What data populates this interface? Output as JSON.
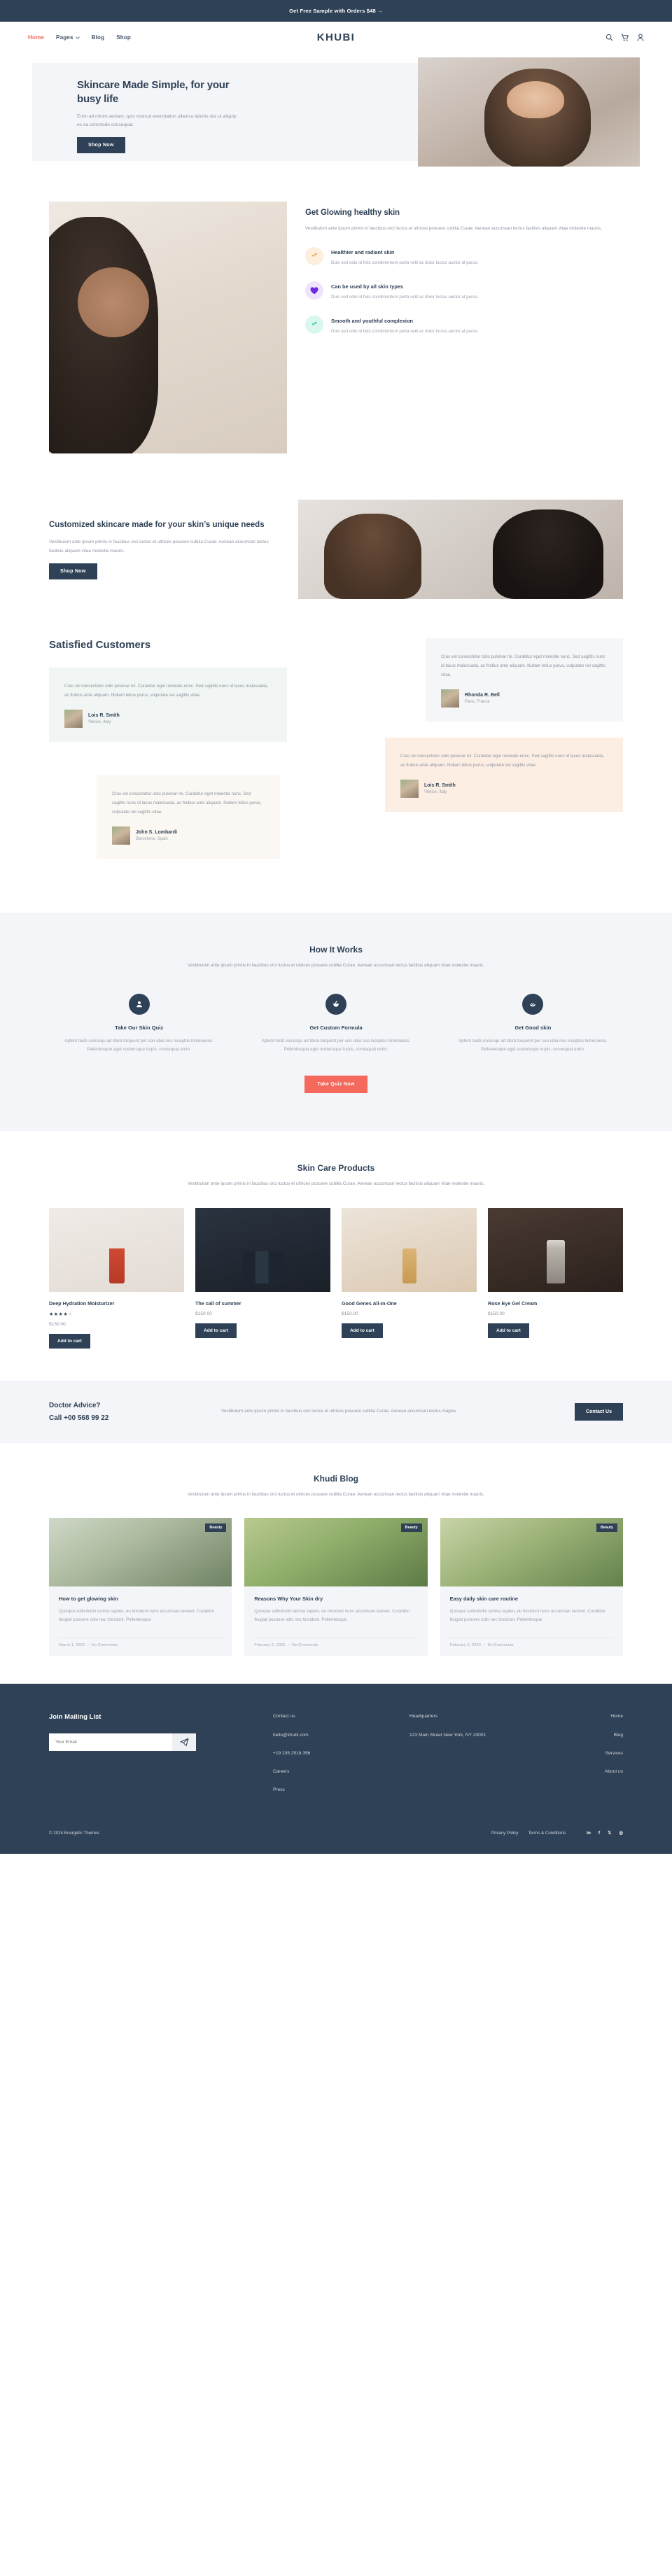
{
  "topbar": {
    "text": "Get Free Sample with Orders $48 →"
  },
  "header": {
    "brand": "KHUBI",
    "nav": [
      {
        "label": "Home",
        "active": true
      },
      {
        "label": "Pages",
        "active": false,
        "has_caret": true
      },
      {
        "label": "Blog",
        "active": false
      },
      {
        "label": "Shop",
        "active": false
      }
    ],
    "icons": [
      "search-icon",
      "cart-icon",
      "account-icon"
    ]
  },
  "hero": {
    "title": "Skincare Made Simple, for your busy life",
    "body": "Enim ad minim veniam, quis nostrud exercitation ullamco laboris nisi ut aliquip ex ea commodo consequat.",
    "cta": "Shop Now"
  },
  "glow": {
    "title": "Get Glowing healthy skin",
    "lead": "Vestibulum ante ipsum primis in faucibus orci luctus et ultrices posuere cubilia Curae. Aenean accumsan lectus facilisis aliquam vitae molestie mauris.",
    "features": [
      {
        "title": "Healthier and radiant skin",
        "body": "Duis sed odio id felis condimentum porta velit ac dolor luctus auctor at purus.",
        "icon": "sprout-icon",
        "icon_color": "#f0962e",
        "bg": "#fdeedd"
      },
      {
        "title": "Can be used by all skin types",
        "body": "Duis sed odio id felis condimentum porta velit ac dolor luctus auctor at purus.",
        "icon": "heart-icon",
        "icon_color": "#6d2ae2",
        "bg": "#eee4fd"
      },
      {
        "title": "Smooth and youthful complexion",
        "body": "Duis sed odio id felis condimentum porta velit ac dolor luctus auctor at purus.",
        "icon": "sprout-icon",
        "icon_color": "#12c79a",
        "bg": "#d9f7ee"
      }
    ]
  },
  "custom": {
    "title": "Customized skincare made for your skin’s unique needs",
    "body": "Vestibulum ante ipsum primis in faucibus orci luctus et ultrices posuere cubilia Curae. Aenean accumsan lectus facilisis aliquam vitae molestie mauris.",
    "cta": "Shop Now"
  },
  "testimonials": {
    "title": "Satisfied Customers",
    "items": [
      {
        "quote": "Cras vel consectetur odio pulvinar mi. Curabitur eget molestie nunc. Sed sagittis nunc id lacus malesuada, ac finibus ante aliquam. Nullam tellus purus, vulputate vel sagittis vitae.",
        "name": "Lois R. Smith",
        "location": "Venice, Italy"
      },
      {
        "quote": "Cras vel consectetur odio pulvinar mi. Curabitur eget molestie nunc. Sed sagittis nunc id lacus malesuada, ac finibus ante aliquam. Nullam tellus purus, vulputate vel sagittis vitae.",
        "name": "Rhonda R. Bell",
        "location": "Paris, France"
      },
      {
        "quote": "Cras vel consectetur odio pulvinar mi. Curabitur eget molestie nunc. Sed sagittis nunc id lacus malesuada, ac finibus ante aliquam. Nullam tellus purus, vulputate vel sagittis vitae.",
        "name": "Lois R. Smith",
        "location": "Venice, Italy"
      },
      {
        "quote": "Cras vel consectetur odio pulvinar mi. Curabitur eget molestie nunc. Sed sagittis nunc id lacus malesuada, ac finibus ante aliquam. Nullam tellus purus, vulputate vel sagittis vitae.",
        "name": "John S. Lombardi",
        "location": "Barcelona, Spain"
      }
    ]
  },
  "how": {
    "title": "How It Works",
    "lead": "Vestibulum ante ipsum primis in faucibus orci luctus et ultrices posuere cubilia Curae. Aenean accumsan lectus facilisis aliquam vitae molestie mauris.",
    "steps": [
      {
        "title": "Take Our Skin Quiz",
        "body": "Aptent taciti sociosqu ad litora torquent per con ubia nos inceptos himenaeos. Pellentesque eget scelerisque turpis, consequat entm.",
        "icon": "person-icon"
      },
      {
        "title": "Get Custom Formula",
        "body": "Aptent taciti sociosqu ad litora torquent per con ubia nos inceptos himenaeos. Pellentesque eget scelerisque turpis, consequat entm.",
        "icon": "mortar-pestle-icon"
      },
      {
        "title": "Get Good skin",
        "body": "Aptent taciti sociosqu ad litora torquent per con ubia nos inceptos himenaeos. Pellentesque eget scelerisque turpis, consequat entm.",
        "icon": "leaf-icon"
      }
    ],
    "cta": "Take Quiz Now",
    "cta_color": "#f4695c"
  },
  "products": {
    "title": "Skin Care Products",
    "lead": "Vestibulum ante ipsum primis in faucibus orci luctus et ultrices posuere cubilia Curae. Aenean accumsan lectus facilisis aliquam vitae molestie mauris.",
    "add_label": "Add to cart",
    "items": [
      {
        "name": "Deep Hydration Moisturizer",
        "price": "$150.00",
        "rating": 4,
        "show_rating": true
      },
      {
        "name": "The call of summer",
        "price": "$150.00",
        "rating": 0,
        "show_rating": false
      },
      {
        "name": "Good Genes All-In-One",
        "price": "$150.00",
        "rating": 0,
        "show_rating": false
      },
      {
        "name": "Rose Eye Gel Cream",
        "price": "$150.00",
        "rating": 0,
        "show_rating": false
      }
    ]
  },
  "doctor": {
    "title": "Doctor Advice?",
    "phone": "Call +00 568 99 22",
    "body": "Vestibulum ante ipsum primis in faucibus orci luctus et ultrices posuere cubilia Curae. Aenean accumsan lectus magna.",
    "cta": "Contact Us"
  },
  "blog": {
    "title": "Khudi Blog",
    "lead": "Vestibulum ante ipsum primis in faucibus orci luctus et ultrices posuere cubilia Curae. Aenean accumsan lectus facilisis aliquam vitae molestie mauris.",
    "posts": [
      {
        "badge": "Beauty",
        "title": "How to get glowing skin",
        "excerpt": "Quisque sollicitudin lacinia sapien, eu tincidunt nunc accumsan laoreet. Curabitur feugiat posuere odio nec tincidunt. Pellentesque",
        "date": "March 1, 2020",
        "comments": "No Comments"
      },
      {
        "badge": "Beauty",
        "title": "Reasons Why Your Skin dry",
        "excerpt": "Quisque sollicitudin lacinia sapien, eu tincidunt nunc accumsan laoreet. Curabitur feugiat posuere odio nec tincidunt. Pellentesque",
        "date": "February 2, 2020",
        "comments": "No Comments"
      },
      {
        "badge": "Beauty",
        "title": "Easy daily skin care routine",
        "excerpt": "Quisque sollicitudin lacinia sapien, eu tincidunt nunc accumsan laoreet. Curabitur feugiat posuere odio nec tincidunt. Pellentesque",
        "date": "February 2, 2020",
        "comments": "No Comments"
      }
    ]
  },
  "footer": {
    "mail_title": "Join Mailing List",
    "email_placeholder": "Your Email",
    "email_value": "",
    "send_icon": "send-icon",
    "contact": [
      "Contact us",
      "hello@khubi.com",
      "+19 235 2518 356",
      "Careers",
      "Press"
    ],
    "hq": [
      "Headquarters",
      "123 Main Street New York, NY 20001"
    ],
    "links": [
      "Home",
      "Blog",
      "Services",
      "About us"
    ],
    "copyright": "© 2024 Energetic Themes",
    "legal": [
      "Privacy Policy",
      "Terms & Conditions"
    ],
    "social": [
      "linkedin-icon",
      "facebook-icon",
      "twitter-icon",
      "instagram-icon"
    ]
  },
  "colors": {
    "dark": "#2f4156",
    "accent": "#f4695c",
    "muted": "#8b93a0",
    "light_bg": "#f4f5f8"
  }
}
